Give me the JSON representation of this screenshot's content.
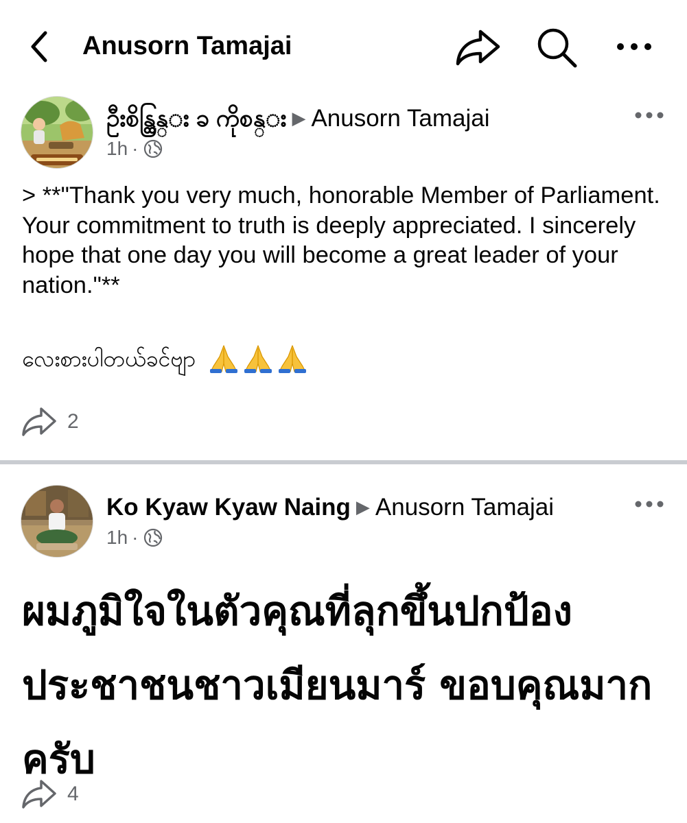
{
  "header": {
    "title": "Anusorn Tamajai",
    "back_icon": "chevron-left-icon",
    "share_icon": "share-icon",
    "search_icon": "search-icon",
    "more_icon": "more-horizontal-icon"
  },
  "posts": [
    {
      "author": "ဦးစိန္ထြန္း ခ ကိုစန္း",
      "target": "Anusorn Tamajai",
      "time": "1h",
      "privacy_icon": "globe-icon",
      "body": "> **\"Thank you very much, honorable Member of Parliament. Your commitment to truth is deeply appreciated. I sincerely hope that one day you will become a great leader of your nation.\"**",
      "myanmar_text": "လေးစားပါတယ်ခင်ဗျာ",
      "emoji_count": 3,
      "share_count": "2"
    },
    {
      "author": "Ko Kyaw Kyaw Naing",
      "target": "Anusorn Tamajai",
      "time": "1h",
      "privacy_icon": "globe-icon",
      "body": "ผมภูมิใจในตัวคุณที่ลุกขึ้นปกป้องประชาชนชาวเมียนมาร์ ขอบคุณมากครับ",
      "share_count": "4"
    }
  ],
  "colors": {
    "text": "#050505",
    "secondary": "#65676b",
    "divider": "#c9ccd1"
  }
}
